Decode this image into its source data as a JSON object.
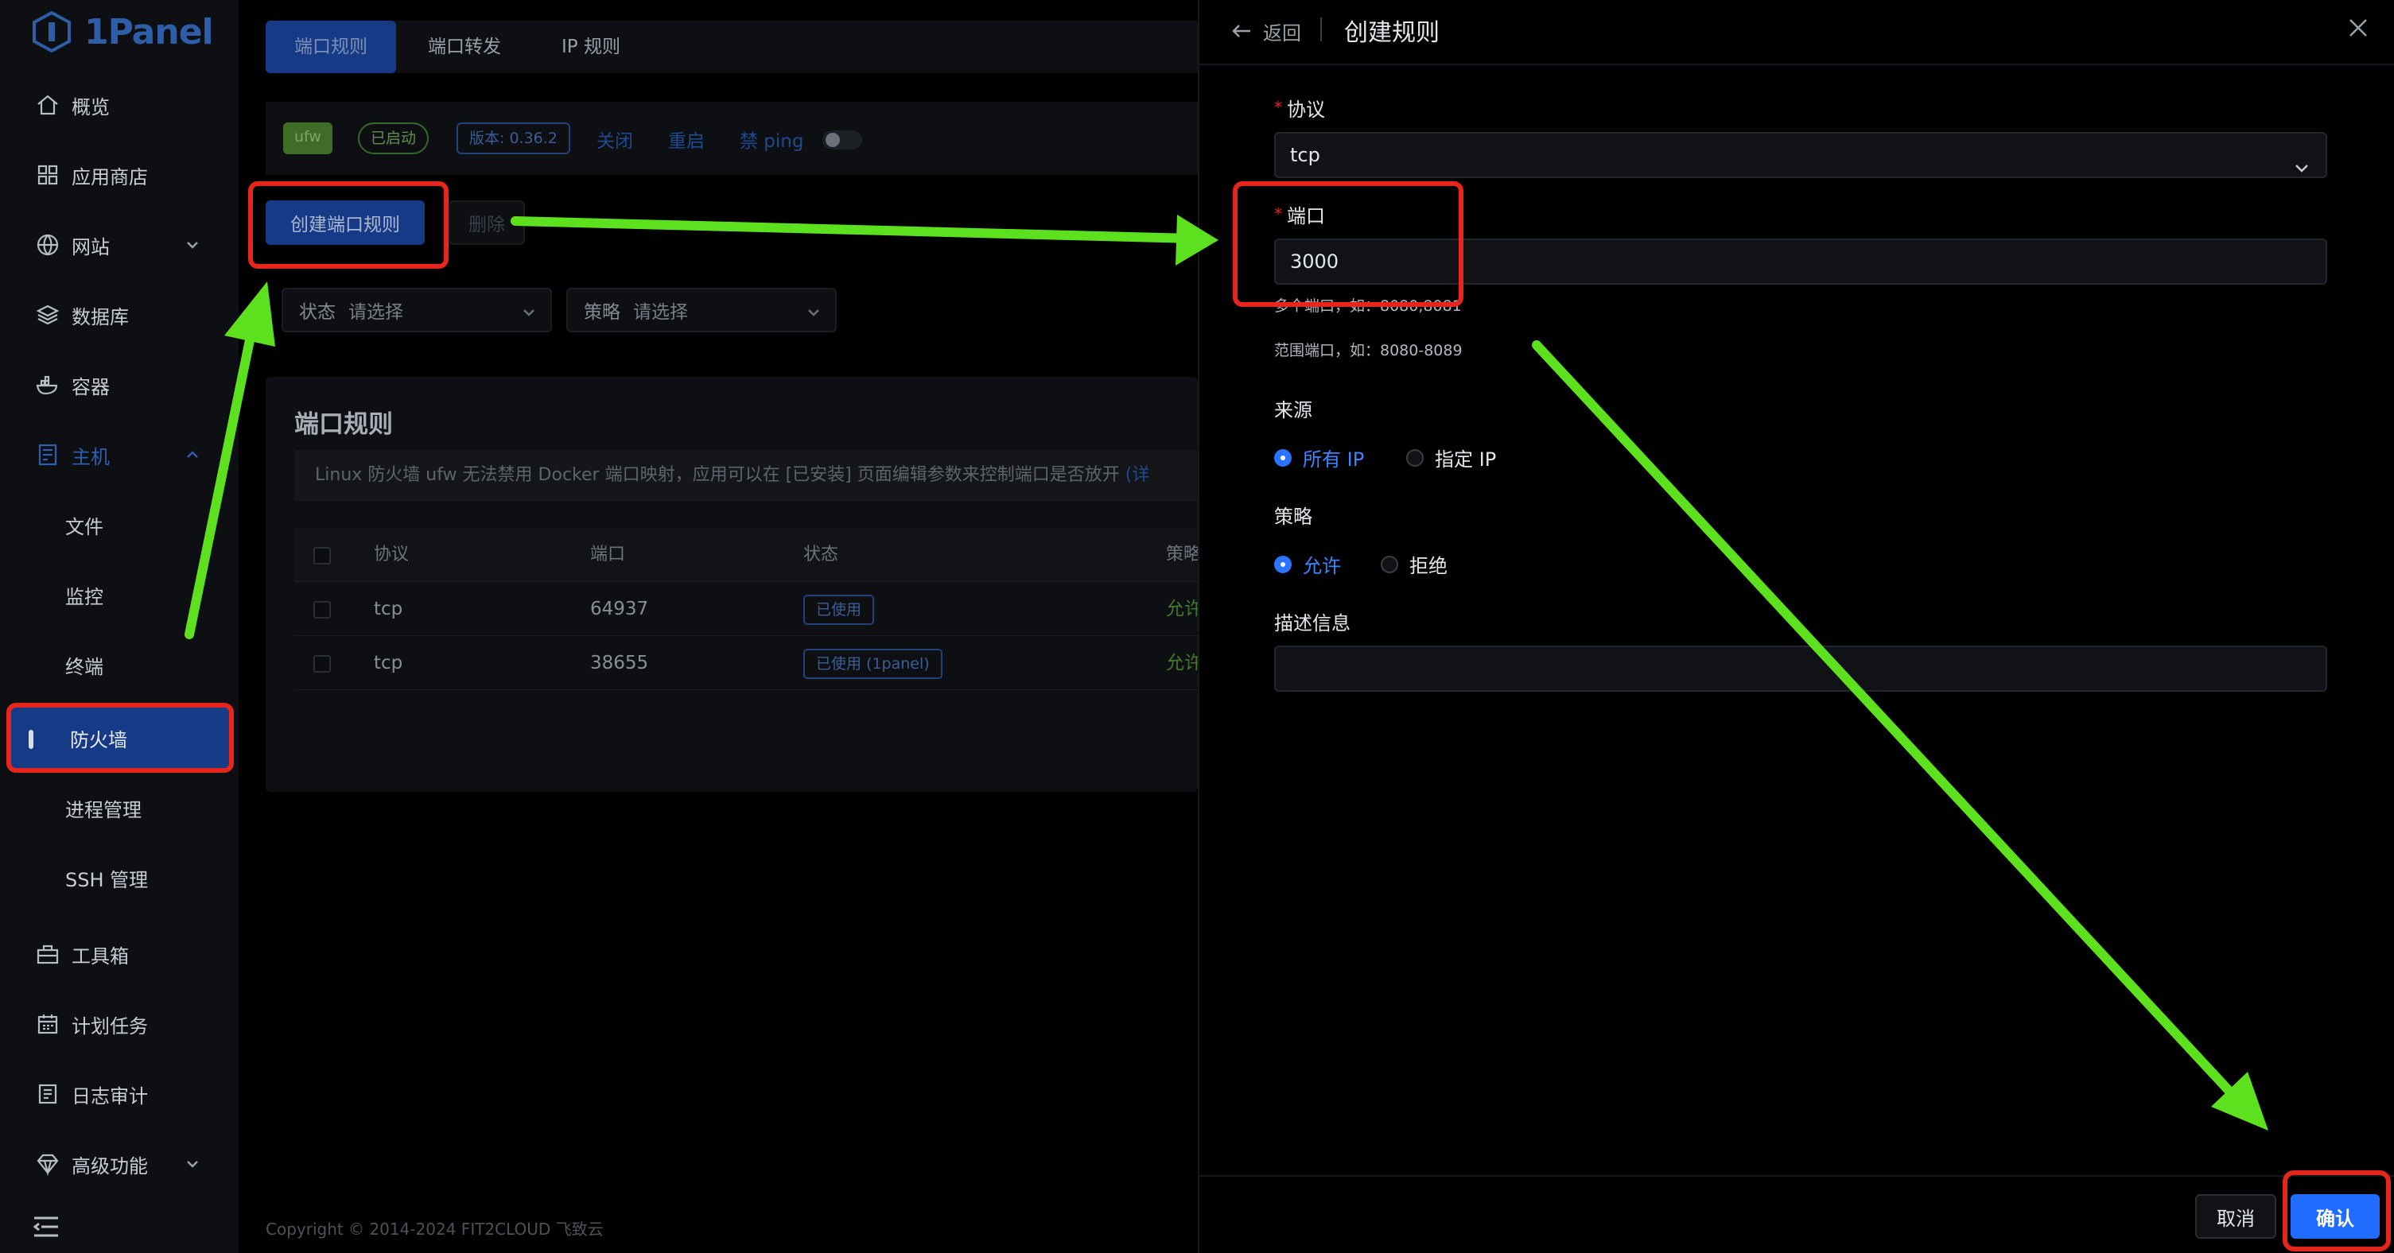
{
  "app": {
    "logo_text": "1Panel"
  },
  "sidebar": {
    "items": [
      {
        "label": "概览"
      },
      {
        "label": "应用商店"
      },
      {
        "label": "网站"
      },
      {
        "label": "数据库"
      },
      {
        "label": "容器"
      },
      {
        "label": "主机"
      },
      {
        "label": "文件"
      },
      {
        "label": "监控"
      },
      {
        "label": "终端"
      },
      {
        "label": "防火墙"
      },
      {
        "label": "进程管理"
      },
      {
        "label": "SSH 管理"
      },
      {
        "label": "工具箱"
      },
      {
        "label": "计划任务"
      },
      {
        "label": "日志审计"
      },
      {
        "label": "高级功能"
      }
    ]
  },
  "main": {
    "tabs": [
      {
        "label": "端口规则"
      },
      {
        "label": "端口转发"
      },
      {
        "label": "IP 规则"
      }
    ],
    "status": {
      "engine": "ufw",
      "state": "已启动",
      "version": "版本: 0.36.2",
      "close": "关闭",
      "restart": "重启",
      "ping_label": "禁 ping"
    },
    "toolbar": {
      "create_label": "创建端口规则",
      "delete_label": "删除"
    },
    "filters": {
      "status_label": "状态",
      "status_placeholder": "请选择",
      "policy_label": "策略",
      "policy_placeholder": "请选择"
    },
    "rules": {
      "title": "端口规则",
      "alert": "Linux 防火墙 ufw 无法禁用 Docker 端口映射，应用可以在 [已安装] 页面编辑参数来控制端口是否放开",
      "alert_more": "(详",
      "columns": {
        "protocol": "协议",
        "port": "端口",
        "status": "状态",
        "policy": "策略"
      },
      "rows": [
        {
          "protocol": "tcp",
          "port": "64937",
          "status": "已使用",
          "policy": "允许"
        },
        {
          "protocol": "tcp",
          "port": "38655",
          "status": "已使用 (1panel)",
          "policy": "允许"
        }
      ]
    },
    "copyright": "Copyright © 2014-2024 FIT2CLOUD 飞致云"
  },
  "drawer": {
    "back": "返回",
    "title": "创建规则",
    "protocol": {
      "label": "协议",
      "value": "tcp"
    },
    "port": {
      "label": "端口",
      "value": "3000",
      "hint_multi": "多个端口，如：8080,8081",
      "hint_range": "范围端口，如：8080-8089"
    },
    "source": {
      "label": "来源",
      "options": [
        "所有 IP",
        "指定 IP"
      ],
      "selected": "所有 IP"
    },
    "strategy": {
      "label": "策略",
      "options": [
        "允许",
        "拒绝"
      ],
      "selected": "允许"
    },
    "description": {
      "label": "描述信息",
      "value": ""
    },
    "footer": {
      "cancel": "取消",
      "confirm": "确认"
    }
  },
  "colors": {
    "accent": "#1f6cff",
    "annotation_frame": "#e6261c",
    "annotation_arrow": "#5de01e",
    "active_nav": "#163a86"
  }
}
